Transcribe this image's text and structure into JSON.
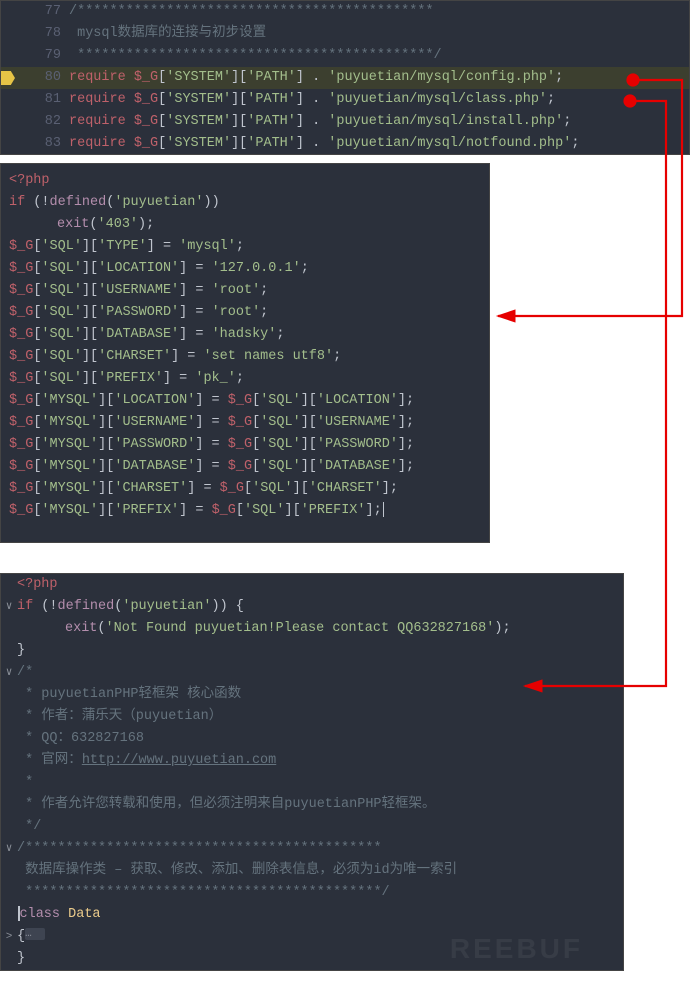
{
  "top": {
    "lines": [
      {
        "num": "77",
        "html": "<span class='cmt'>/********************************************</span>"
      },
      {
        "num": "78",
        "html": "<span class='cmt'> mysql数据库的连接与初步设置</span>"
      },
      {
        "num": "79",
        "html": "<span class='cmt'> ********************************************/</span>"
      },
      {
        "num": "80",
        "bp": true,
        "hl": true,
        "html": "<span class='kw2'>require</span> <span class='var'>$_G</span>[<span class='str'>'SYSTEM'</span>][<span class='str'>'PATH'</span>] . <span class='str'>'puyuetian/mysql/config.php'</span>;"
      },
      {
        "num": "81",
        "html": "<span class='kw2'>require</span> <span class='var'>$_G</span>[<span class='str'>'SYSTEM'</span>][<span class='str'>'PATH'</span>] . <span class='str'>'puyuetian/mysql/class.php'</span>;"
      },
      {
        "num": "82",
        "html": "<span class='kw2'>require</span> <span class='var'>$_G</span>[<span class='str'>'SYSTEM'</span>][<span class='str'>'PATH'</span>] . <span class='str'>'puyuetian/mysql/install.php'</span>;"
      },
      {
        "num": "83",
        "html": "<span class='kw2'>require</span> <span class='var'>$_G</span>[<span class='str'>'SYSTEM'</span>][<span class='str'>'PATH'</span>] . <span class='str'>'puyuetian/mysql/notfound.php'</span>;"
      }
    ]
  },
  "mid": {
    "lines": [
      "<span class='opn'>&lt;?php</span>",
      "<span class='kw2'>if</span> (!<span class='kw'>defined</span>(<span class='str'>'puyuetian'</span>))",
      "<span class='ind2'></span><span class='kw'>exit</span>(<span class='str'>'403'</span>);",
      "<span class='var'>$_G</span>[<span class='str'>'SQL'</span>][<span class='str'>'TYPE'</span>] = <span class='str'>'mysql'</span>;",
      "<span class='var'>$_G</span>[<span class='str'>'SQL'</span>][<span class='str'>'LOCATION'</span>] = <span class='str'>'127.0.0.1'</span>;",
      "<span class='var'>$_G</span>[<span class='str'>'SQL'</span>][<span class='str'>'USERNAME'</span>] = <span class='str'>'root'</span>;",
      "<span class='var'>$_G</span>[<span class='str'>'SQL'</span>][<span class='str'>'PASSWORD'</span>] = <span class='str'>'root'</span>;",
      "<span class='var'>$_G</span>[<span class='str'>'SQL'</span>][<span class='str'>'DATABASE'</span>] = <span class='str'>'hadsky'</span>;",
      "<span class='var'>$_G</span>[<span class='str'>'SQL'</span>][<span class='str'>'CHARSET'</span>] = <span class='str'>'set names utf8'</span>;",
      "<span class='var'>$_G</span>[<span class='str'>'SQL'</span>][<span class='str'>'PREFIX'</span>] = <span class='str'>'pk_'</span>;",
      "<span class='var'>$_G</span>[<span class='str'>'MYSQL'</span>][<span class='str'>'LOCATION'</span>] = <span class='var'>$_G</span>[<span class='str'>'SQL'</span>][<span class='str'>'LOCATION'</span>];",
      "<span class='var'>$_G</span>[<span class='str'>'MYSQL'</span>][<span class='str'>'USERNAME'</span>] = <span class='var'>$_G</span>[<span class='str'>'SQL'</span>][<span class='str'>'USERNAME'</span>];",
      "<span class='var'>$_G</span>[<span class='str'>'MYSQL'</span>][<span class='str'>'PASSWORD'</span>] = <span class='var'>$_G</span>[<span class='str'>'SQL'</span>][<span class='str'>'PASSWORD'</span>];",
      "<span class='var'>$_G</span>[<span class='str'>'MYSQL'</span>][<span class='str'>'DATABASE'</span>] = <span class='var'>$_G</span>[<span class='str'>'SQL'</span>][<span class='str'>'DATABASE'</span>];",
      "<span class='var'>$_G</span>[<span class='str'>'MYSQL'</span>][<span class='str'>'CHARSET'</span>] = <span class='var'>$_G</span>[<span class='str'>'SQL'</span>][<span class='str'>'CHARSET'</span>];",
      "<span class='var'>$_G</span>[<span class='str'>'MYSQL'</span>][<span class='str'>'PREFIX'</span>] = <span class='var'>$_G</span>[<span class='str'>'SQL'</span>][<span class='str'>'PREFIX'</span>];<span class='cursor-blink'></span>"
    ]
  },
  "bot": {
    "lines": [
      {
        "fold": "",
        "html": "<span class='opn'>&lt;?php</span>"
      },
      {
        "fold": "∨",
        "html": "<span class='kw2'>if</span> (!<span class='kw'>defined</span>(<span class='str'>'puyuetian'</span>)) {"
      },
      {
        "fold": "",
        "html": "<span class='ind2'></span><span class='kw'>exit</span>(<span class='str'>'Not Found puyuetian!Please contact QQ632827168'</span>);"
      },
      {
        "fold": "",
        "html": "}"
      },
      {
        "fold": "∨",
        "html": "<span class='cmt'>/*</span>"
      },
      {
        "fold": "",
        "html": "<span class='cmt'> * puyuetianPHP轻框架 核心函数</span>"
      },
      {
        "fold": "",
        "html": "<span class='cmt'> * 作者：蒲乐天（puyuetian）</span>"
      },
      {
        "fold": "",
        "html": "<span class='cmt'> * QQ：632827168</span>"
      },
      {
        "fold": "",
        "html": "<span class='cmt'> * 官网：<span class='link'>http://www.puyuetian.com</span></span>"
      },
      {
        "fold": "",
        "html": "<span class='cmt'> *</span>"
      },
      {
        "fold": "",
        "html": "<span class='cmt'> * 作者允许您转载和使用，但必须注明来自puyuetianPHP轻框架。</span>"
      },
      {
        "fold": "",
        "html": "<span class='cmt'> */</span>"
      },
      {
        "fold": "∨",
        "html": "<span class='cmt'>/********************************************</span>"
      },
      {
        "fold": "",
        "html": "<span class='cmt'> 数据库操作类 – 获取、修改、添加、删除表信息，必须为id为唯一索引</span>"
      },
      {
        "fold": "",
        "html": "<span class='cmt'> ********************************************/</span>"
      },
      {
        "fold": "",
        "html": "<span class='cursor-blink'></span><span class='kw'>class</span> <span class='cls'>Data</span>"
      },
      {
        "fold": ">",
        "html": "{<span class='ellipsis-box'></span>"
      },
      {
        "fold": "",
        "html": "}"
      }
    ]
  },
  "watermark": "REEBUF"
}
